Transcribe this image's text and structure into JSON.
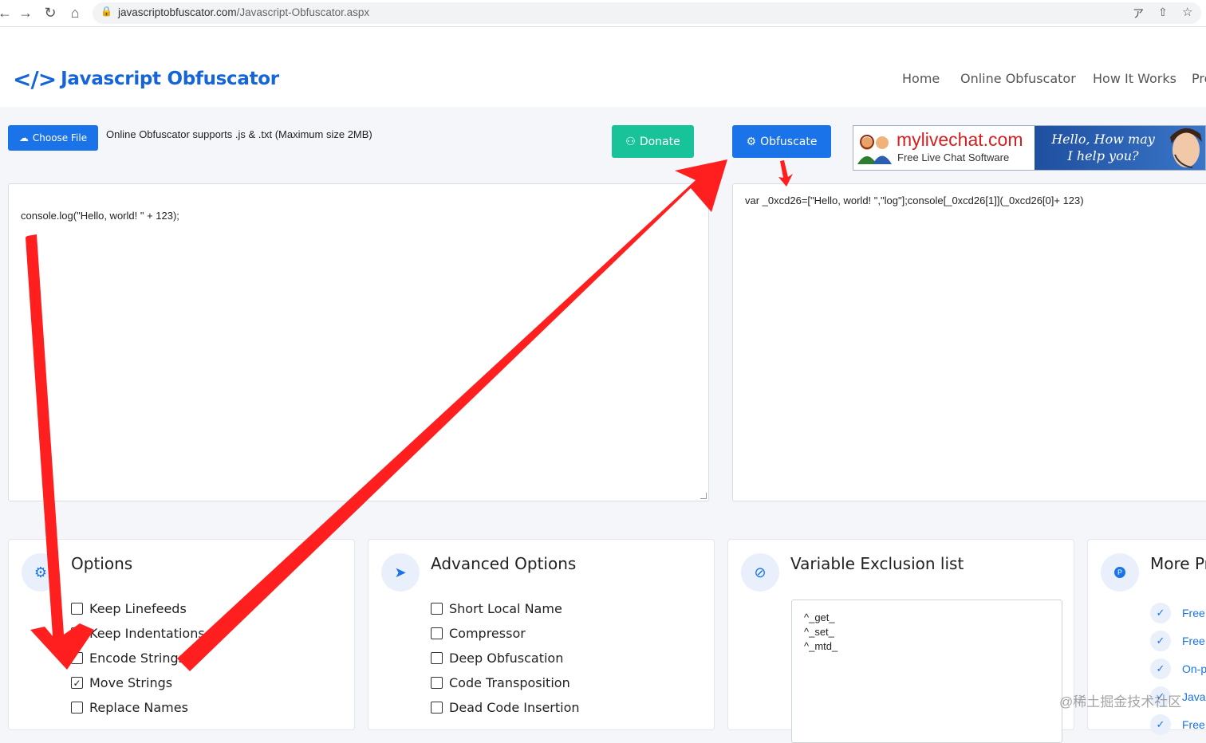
{
  "browser": {
    "url_domain": "javascriptobfuscator.com",
    "url_path": "/Javascript-Obfuscator.aspx",
    "icons": [
      "back-icon",
      "forward-icon",
      "reload-icon",
      "home-icon",
      "lock-icon",
      "translate-icon",
      "share-icon",
      "star-icon"
    ]
  },
  "header": {
    "logo_mark": "</>",
    "logo_text": "Javascript Obfuscator",
    "nav": [
      "Home",
      "Online Obfuscator",
      "How It Works",
      "Pro"
    ]
  },
  "toolbar": {
    "choose_file": "Choose File",
    "support_text": "Online Obfuscator supports .js & .txt (Maximum size 2MB)",
    "donate": "Donate",
    "obfuscate": "Obfuscate"
  },
  "ad": {
    "brand": "mylivechat.com",
    "subtitle": "Free Live Chat Software",
    "hello": "Hello, How may I help you?"
  },
  "input_code": "console.log(\"Hello, world! \" + 123);",
  "output_code": "var _0xcd26=[\"Hello, world! \",\"log\"];console[_0xcd26[1]](_0xcd26[0]+ 123)",
  "options": {
    "title": "Options",
    "items": [
      {
        "label": "Keep Linefeeds",
        "checked": false
      },
      {
        "label": "Keep Indentations",
        "checked": false
      },
      {
        "label": "Encode Strings",
        "checked": false
      },
      {
        "label": "Move Strings",
        "checked": true
      },
      {
        "label": "Replace Names",
        "checked": false
      }
    ]
  },
  "advanced": {
    "title": "Advanced Options",
    "items": [
      {
        "label": "Short Local Name",
        "checked": false
      },
      {
        "label": "Compressor",
        "checked": false
      },
      {
        "label": "Deep Obfuscation",
        "checked": false
      },
      {
        "label": "Code Transposition",
        "checked": false
      },
      {
        "label": "Dead Code Insertion",
        "checked": false
      }
    ]
  },
  "exclusion": {
    "title": "Variable Exclusion list",
    "lines": [
      "^_get_",
      "^_set_",
      "^_mtd_"
    ]
  },
  "more_pro": {
    "title": "More Pr",
    "items": [
      "Free",
      "Free",
      "On-p",
      "Java",
      "Free"
    ]
  },
  "watermark": "@稀土掘金技术社区",
  "colors": {
    "brand_blue": "#1a73e8",
    "donate_green": "#19c39a",
    "annotation_red": "#ff1f1f"
  }
}
